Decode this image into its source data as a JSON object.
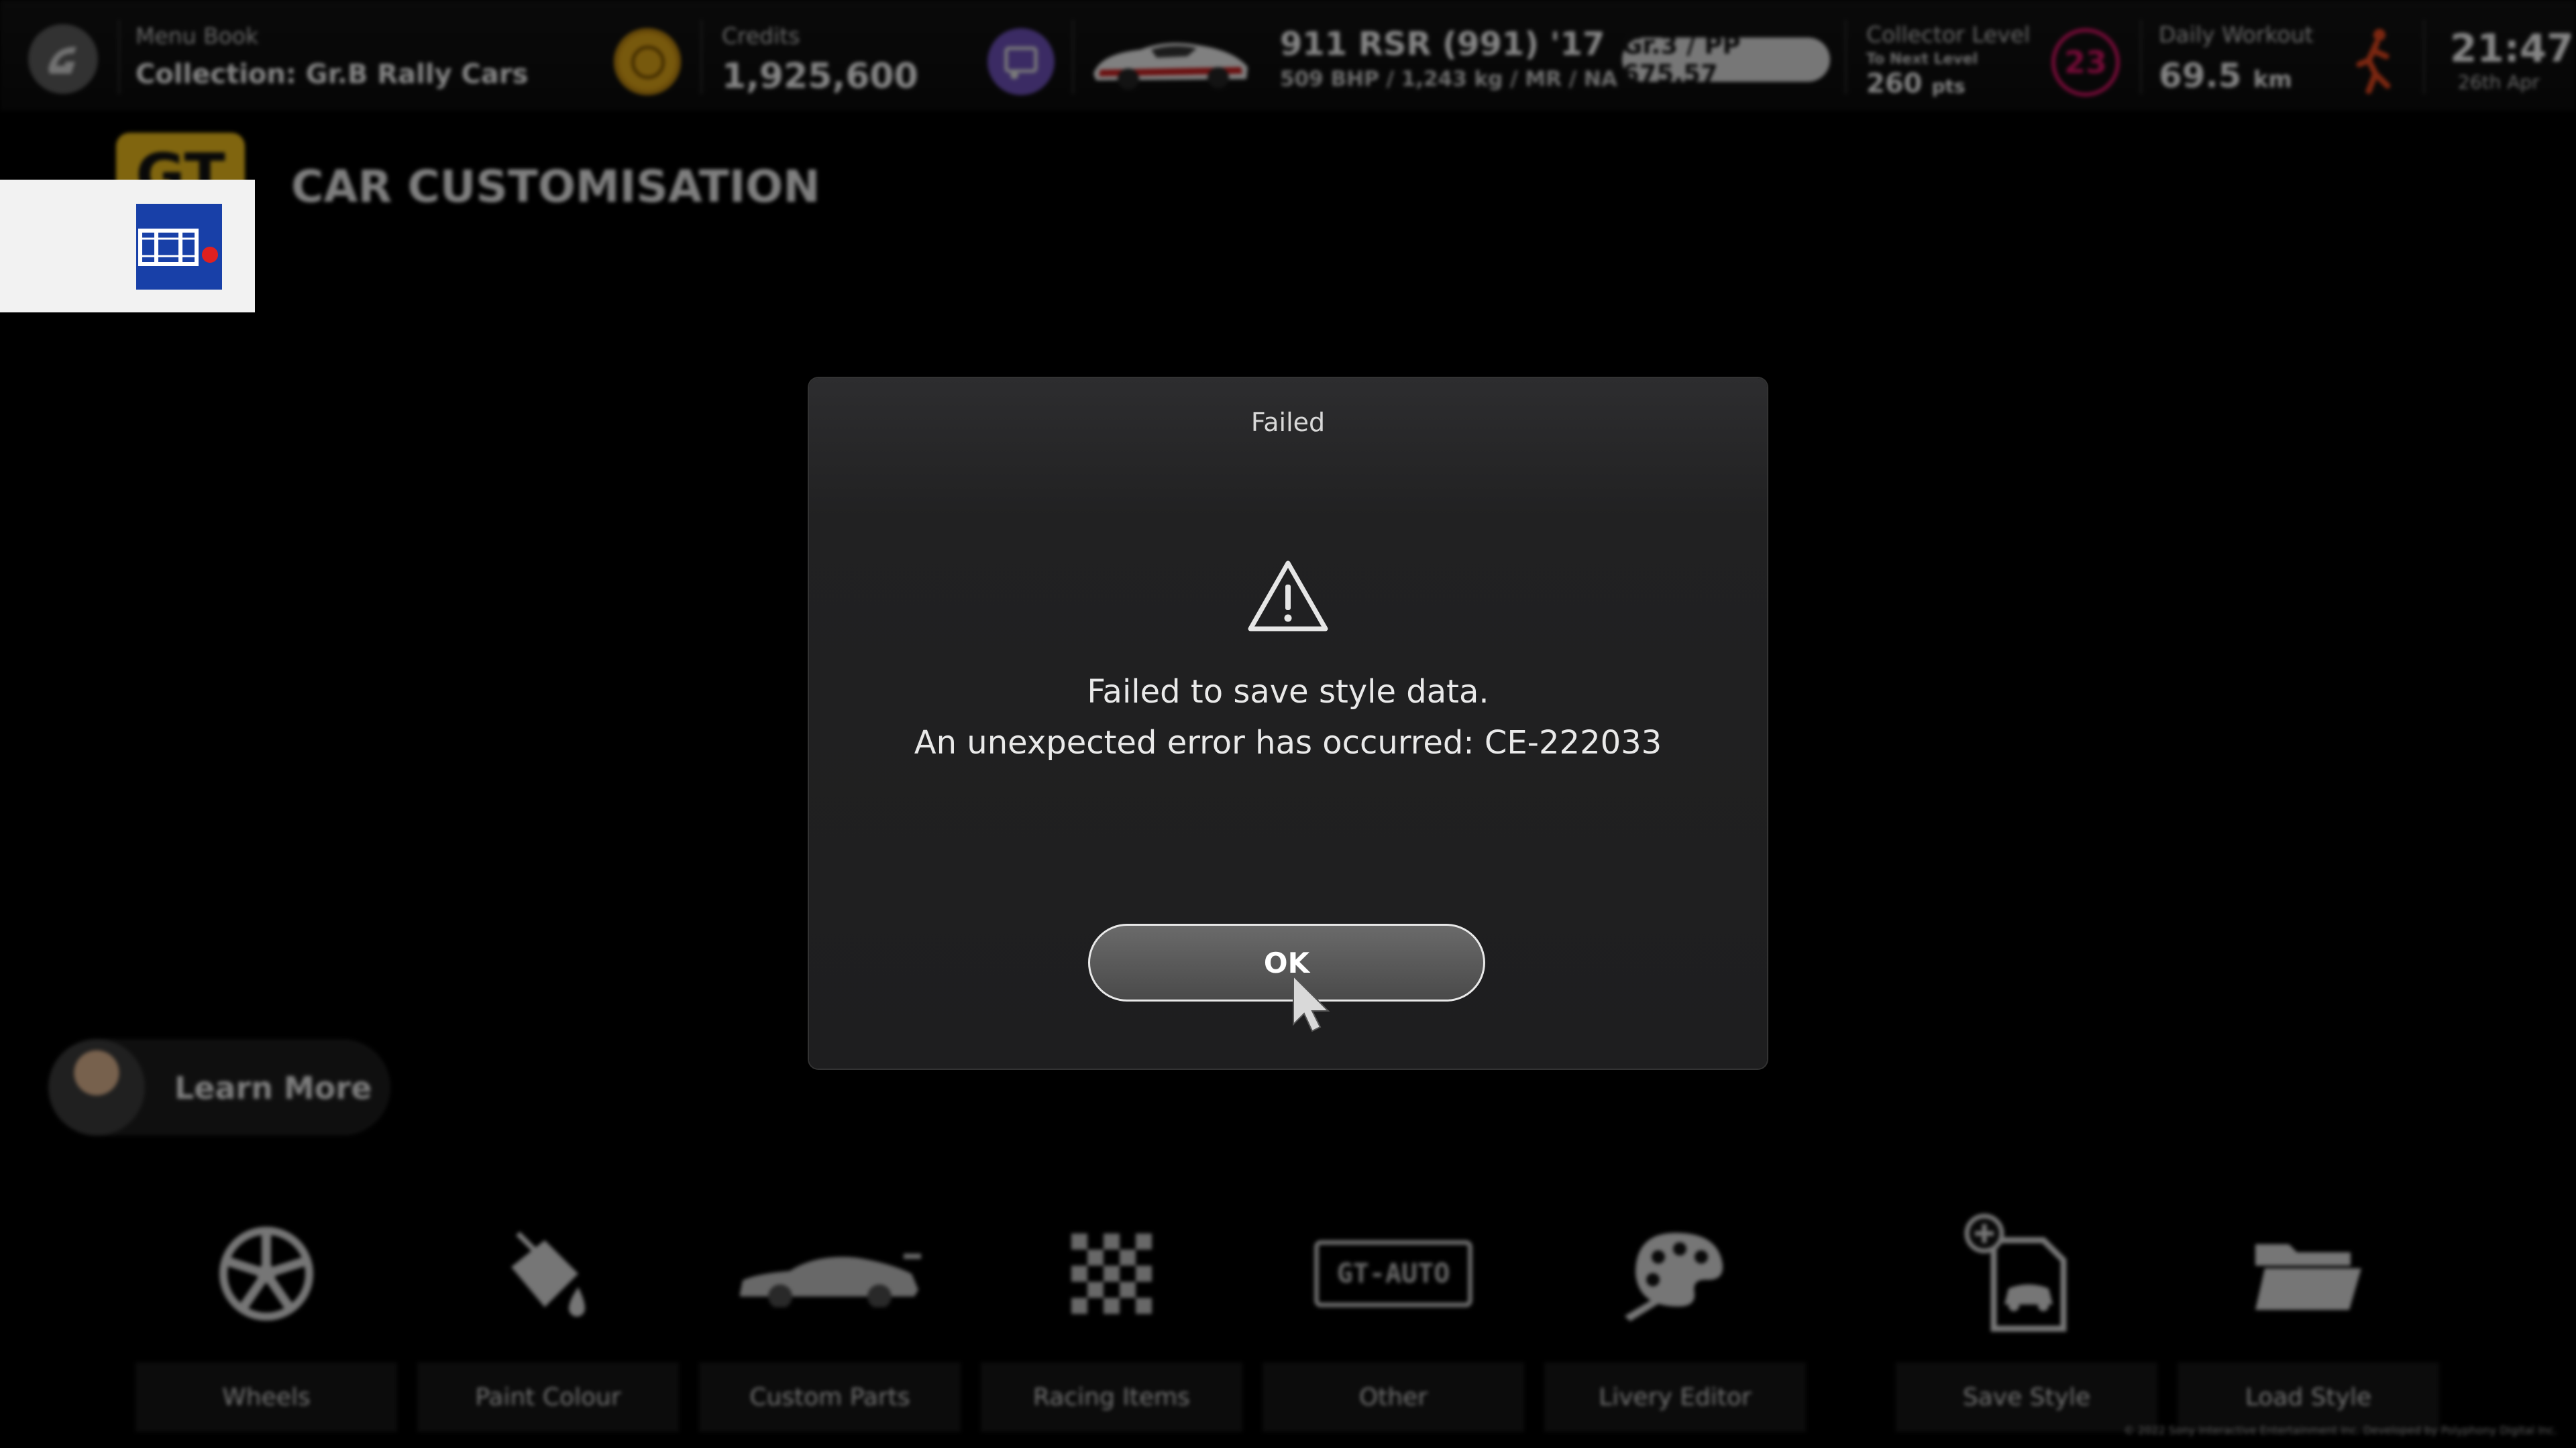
{
  "hud": {
    "menu_book_label": "Menu Book",
    "menu_book_value": "Collection: Gr.B Rally Cars",
    "credits_label": "Credits",
    "credits_value": "1,925,600",
    "car_name": "911 RSR (991) '17",
    "car_specs": "509 BHP / 1,243 kg / MR / NA",
    "pp_badge": "Gr.3 / PP 675.57",
    "collector_label": "Collector Level",
    "collector_sub": "To Next Level",
    "collector_pts": "260",
    "collector_pts_unit": "pts",
    "collector_level": "23",
    "workout_label": "Daily Workout",
    "workout_value": "69.5",
    "workout_unit": "km",
    "time": "21:47",
    "date": "26th Apr",
    "accent_level": "#d11463",
    "accent_workout": "#e0461e",
    "accent_coin": "#d9a117"
  },
  "header": {
    "logo_text": "GT",
    "title": "CAR CUSTOMISATION"
  },
  "learn_more": {
    "label": "Learn More"
  },
  "menu": {
    "items": [
      {
        "label": "Wheels",
        "icon": "wheel-icon"
      },
      {
        "label": "Paint Colour",
        "icon": "paint-bucket-icon"
      },
      {
        "label": "Custom Parts",
        "icon": "car-side-icon"
      },
      {
        "label": "Racing Items",
        "icon": "checkered-flag-icon"
      },
      {
        "label": "Other",
        "icon": "license-plate-icon"
      },
      {
        "label": "Livery Editor",
        "icon": "palette-icon"
      },
      {
        "label": "Save Style",
        "icon": "save-style-icon"
      },
      {
        "label": "Load Style",
        "icon": "folder-icon"
      }
    ],
    "plate_text": "GT-AUTO"
  },
  "copyright": "© 2022 Sony Interactive Entertainment Inc. Developed by Polyphony Digital Inc.",
  "modal": {
    "title": "Failed",
    "message_line1": "Failed to save style data.",
    "message_line2": "An unexpected error has occurred: CE-222033",
    "ok_label": "OK"
  },
  "overlay": {
    "icon": "film-record-icon",
    "icon_color": "#1840a8",
    "dot_color": "#e02020"
  }
}
